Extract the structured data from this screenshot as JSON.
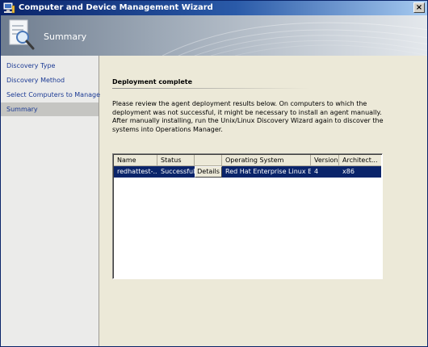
{
  "window": {
    "title": "Computer and Device Management Wizard",
    "close_glyph": "×"
  },
  "banner": {
    "title": "Summary",
    "icon": "summary-document-magnifier-icon"
  },
  "nav": {
    "items": [
      {
        "label": "Discovery Type",
        "active": false
      },
      {
        "label": "Discovery Method",
        "active": false
      },
      {
        "label": "Select Computers to Manage",
        "active": false
      },
      {
        "label": "Summary",
        "active": true
      }
    ]
  },
  "main": {
    "heading": "Deployment complete",
    "description": "Please review the agent deployment results below. On computers to which the deployment was not successful, it might be necessary to install an agent manually. After manually installing, run the Unix/Linux Discovery Wizard again to discover the systems into Operations Manager.",
    "results": {
      "columns": [
        "Name",
        "Status",
        "",
        "Operating System",
        "Version",
        "Architect..."
      ],
      "rows": [
        {
          "name": "redhattest-...",
          "status": "Successful",
          "details_label": "Details",
          "os": "Red Hat Enterprise Linux ES",
          "version": "4",
          "arch": "x86",
          "selected": true
        }
      ]
    }
  },
  "colors": {
    "title_bar": "#0a246a",
    "selection": "#0a246a",
    "nav_link": "#1b3a94",
    "nav_active_bg": "#c5c5c2",
    "dialog_bg": "#ece9d8"
  }
}
